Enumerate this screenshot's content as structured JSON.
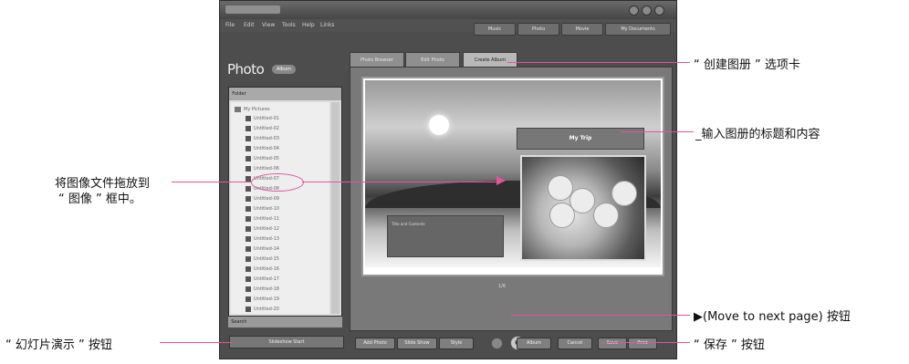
{
  "app": {
    "menus": [
      "File",
      "Edit",
      "View",
      "Tools",
      "Help",
      "Links"
    ],
    "top_buttons": [
      "Music",
      "Photo",
      "Movie",
      "My Documents"
    ],
    "title": "Photo",
    "badge": "Album"
  },
  "left_panel": {
    "header": "Folder",
    "root": "My Pictures",
    "files": [
      "Untitled-01",
      "Untitled-02",
      "Untitled-03",
      "Untitled-04",
      "Untitled-05",
      "Untitled-06",
      "Untitled-07",
      "Untitled-08",
      "Untitled-09",
      "Untitled-10",
      "Untitled-11",
      "Untitled-12",
      "Untitled-13",
      "Untitled-14",
      "Untitled-15",
      "Untitled-16",
      "Untitled-17",
      "Untitled-18",
      "Untitled-19",
      "Untitled-20"
    ],
    "footer": "Search",
    "slideshow": "Slideshow Start"
  },
  "tabs": [
    "Photo Browser",
    "Edit Photo",
    "Create Album"
  ],
  "content": {
    "album_title": "My Trip",
    "text_box_label": "Title and Contents",
    "page_indicator": "1/6",
    "next_symbol": "▶"
  },
  "bottom_buttons": [
    "Add Photo",
    "Slide Show",
    "Style",
    "Album",
    "Cancel",
    "Save",
    "Print"
  ],
  "callouts": {
    "create_album_tab": "“ 创建图册 ” 选项卡",
    "enter_title": "_输入图册的标题和内容",
    "drag_file_line1": "将图像文件拖放到",
    "drag_file_line2": "“ 图像 ” 框中。",
    "next_page": "▶(Move to next page) 按钮",
    "slideshow_button": "“ 幻灯片演示 ” 按钮",
    "save_button": "“ 保存 ” 按钮"
  },
  "colors": {
    "callout_line": "#e0559c",
    "window_bg": "#4d4d4d"
  }
}
